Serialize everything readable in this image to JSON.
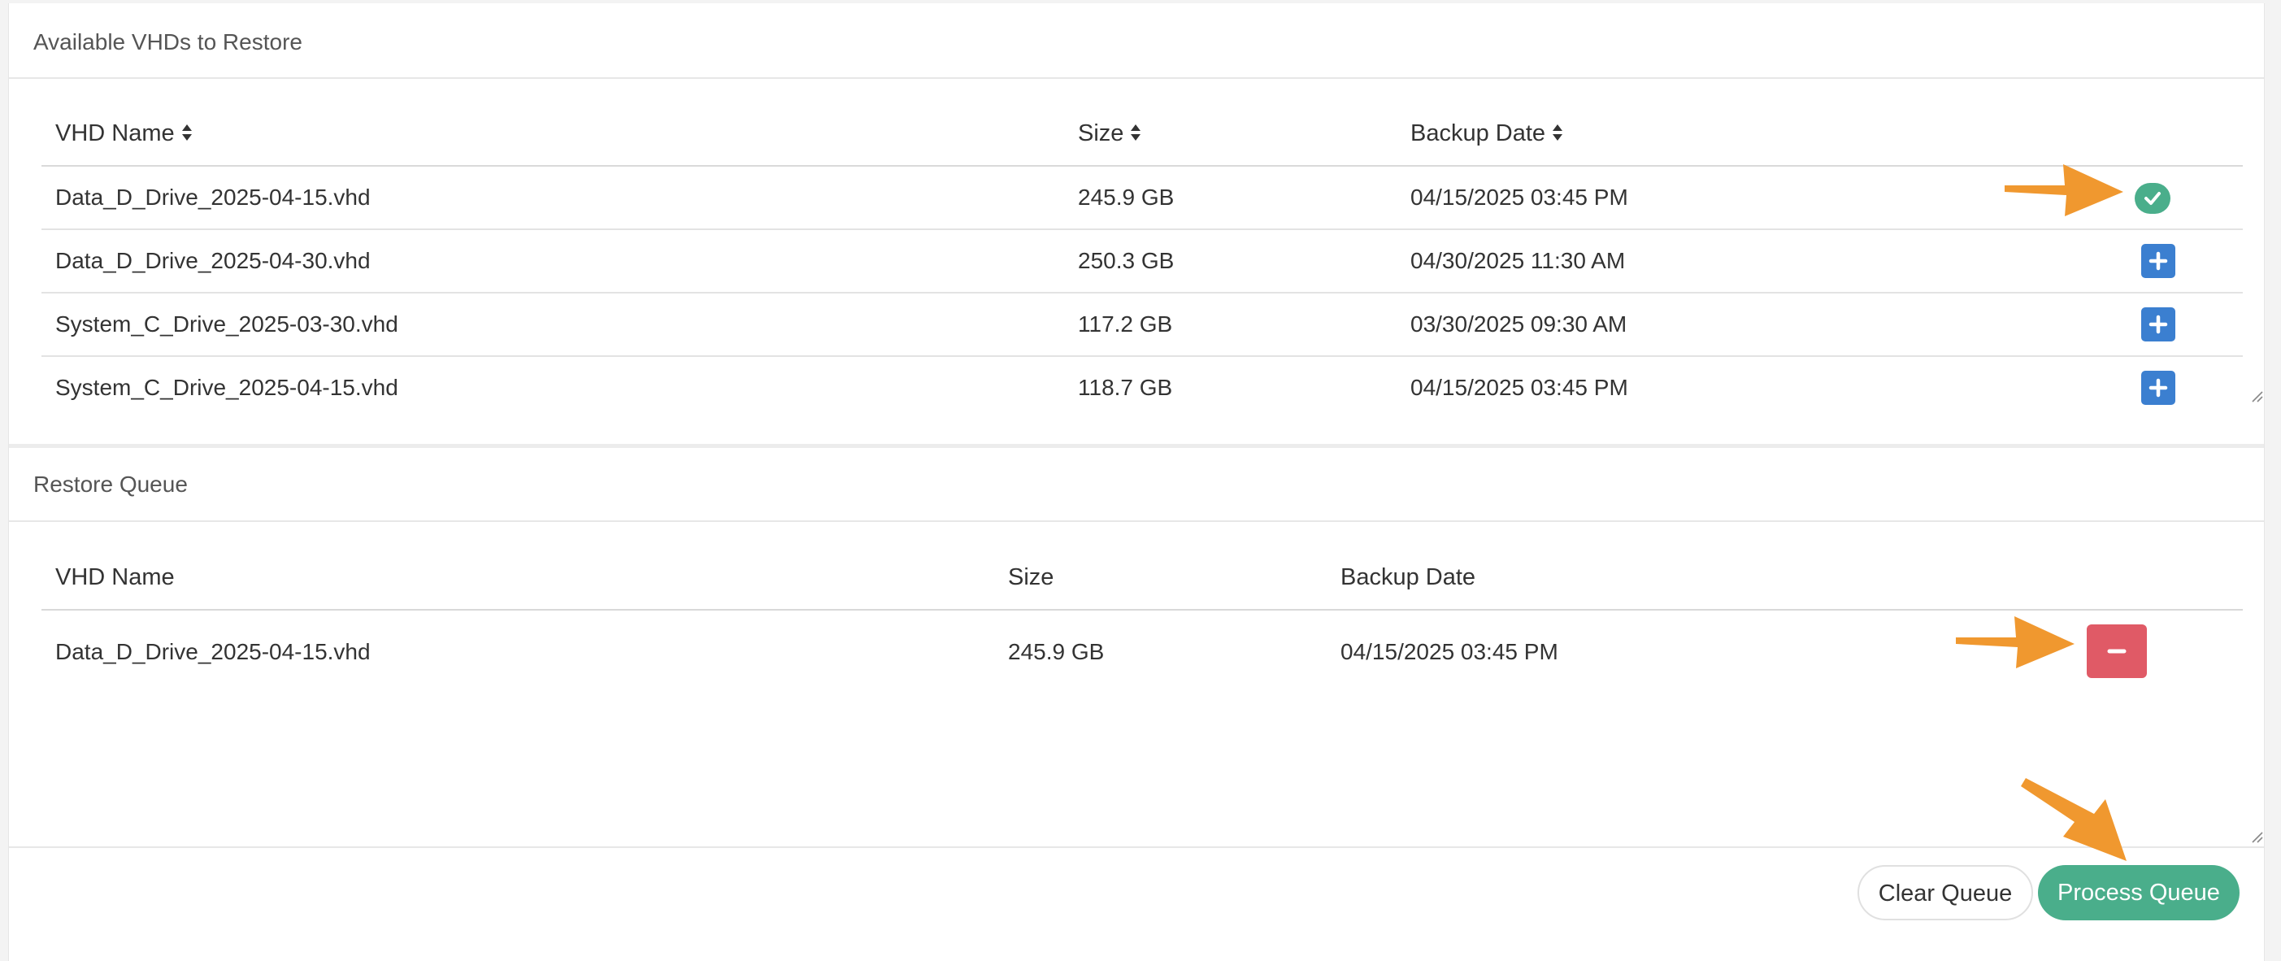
{
  "available": {
    "title": "Available VHDs to Restore",
    "headers": {
      "name": "VHD Name",
      "size": "Size",
      "date": "Backup Date"
    },
    "rows": [
      {
        "name": "Data_D_Drive_2025-04-15.vhd",
        "size": "245.9 GB",
        "date": "04/15/2025 03:45 PM",
        "action": "added-check"
      },
      {
        "name": "Data_D_Drive_2025-04-30.vhd",
        "size": "250.3 GB",
        "date": "04/30/2025 11:30 AM",
        "action": "add"
      },
      {
        "name": "System_C_Drive_2025-03-30.vhd",
        "size": "117.2 GB",
        "date": "03/30/2025 09:30 AM",
        "action": "add"
      },
      {
        "name": "System_C_Drive_2025-04-15.vhd",
        "size": "118.7 GB",
        "date": "04/15/2025 03:45 PM",
        "action": "add"
      }
    ]
  },
  "queue": {
    "title": "Restore Queue",
    "headers": {
      "name": "VHD Name",
      "size": "Size",
      "date": "Backup Date"
    },
    "rows": [
      {
        "name": "Data_D_Drive_2025-04-15.vhd",
        "size": "245.9 GB",
        "date": "04/15/2025 03:45 PM",
        "action": "remove"
      }
    ]
  },
  "footer": {
    "clear_label": "Clear Queue",
    "process_label": "Process Queue"
  },
  "icons": {
    "sort": "sort-icon",
    "check": "check-icon",
    "plus": "plus-icon",
    "minus": "minus-icon",
    "annotation_arrow": "arrow-icon"
  },
  "colors": {
    "primary_blue": "#3b7fd0",
    "success_green": "#4aae8b",
    "danger_red": "#e05a66",
    "annotation_orange": "#f0982f"
  }
}
